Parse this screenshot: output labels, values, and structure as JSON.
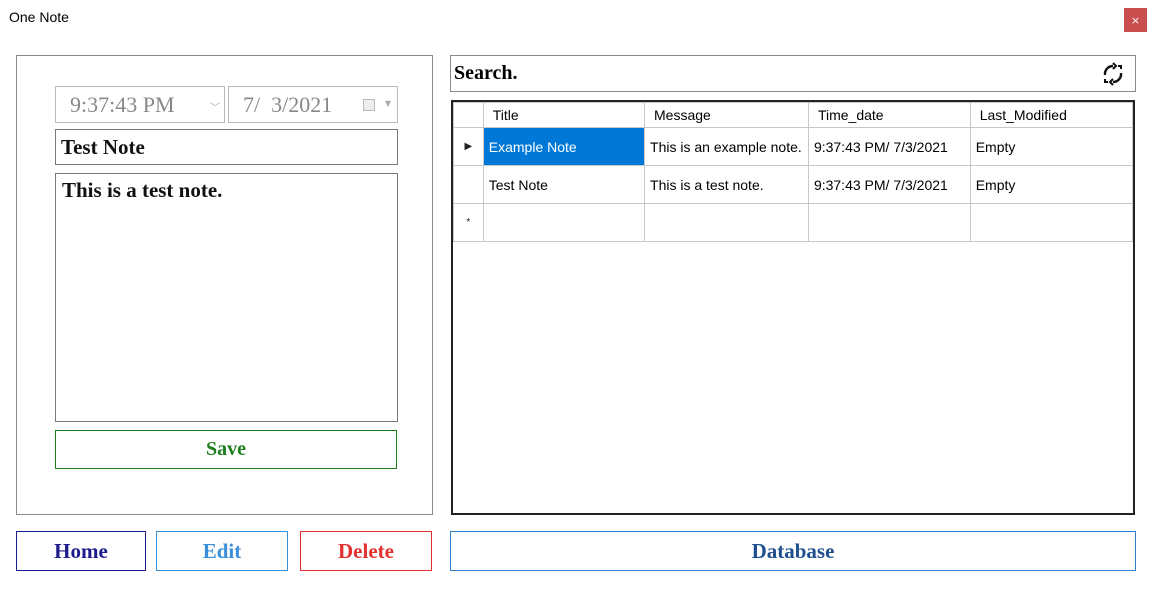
{
  "window": {
    "title": "One Note",
    "close_label": "×"
  },
  "editor": {
    "time_value": "9:37:43 PM",
    "date_value": "7/  3/2021",
    "title_value": "Test Note",
    "message_value": "This is a test note.",
    "save_label": "Save"
  },
  "search": {
    "placeholder": "Search.",
    "refresh_icon": "refresh-icon"
  },
  "grid": {
    "columns": [
      "Title",
      "Message",
      "Time_date",
      "Last_Modified"
    ],
    "rows": [
      {
        "marker": "▶",
        "title": "Example Note",
        "message": "This is an example note.",
        "time_date": "9:37:43 PM/ 7/3/2021",
        "last_modified": "Empty"
      },
      {
        "marker": "",
        "title": "Test Note",
        "message": "This is a test note.",
        "time_date": "9:37:43 PM/ 7/3/2021",
        "last_modified": "Empty"
      }
    ],
    "new_row_marker": "*"
  },
  "nav": {
    "home": "Home",
    "edit": "Edit",
    "delete": "Delete",
    "database": "Database"
  },
  "colors": {
    "save": "#1e7e1e",
    "home": "#1c1c8c",
    "edit": "#3a8fd9",
    "delete": "#e23030",
    "selection": "#0078d7",
    "close": "#c94f4f"
  }
}
